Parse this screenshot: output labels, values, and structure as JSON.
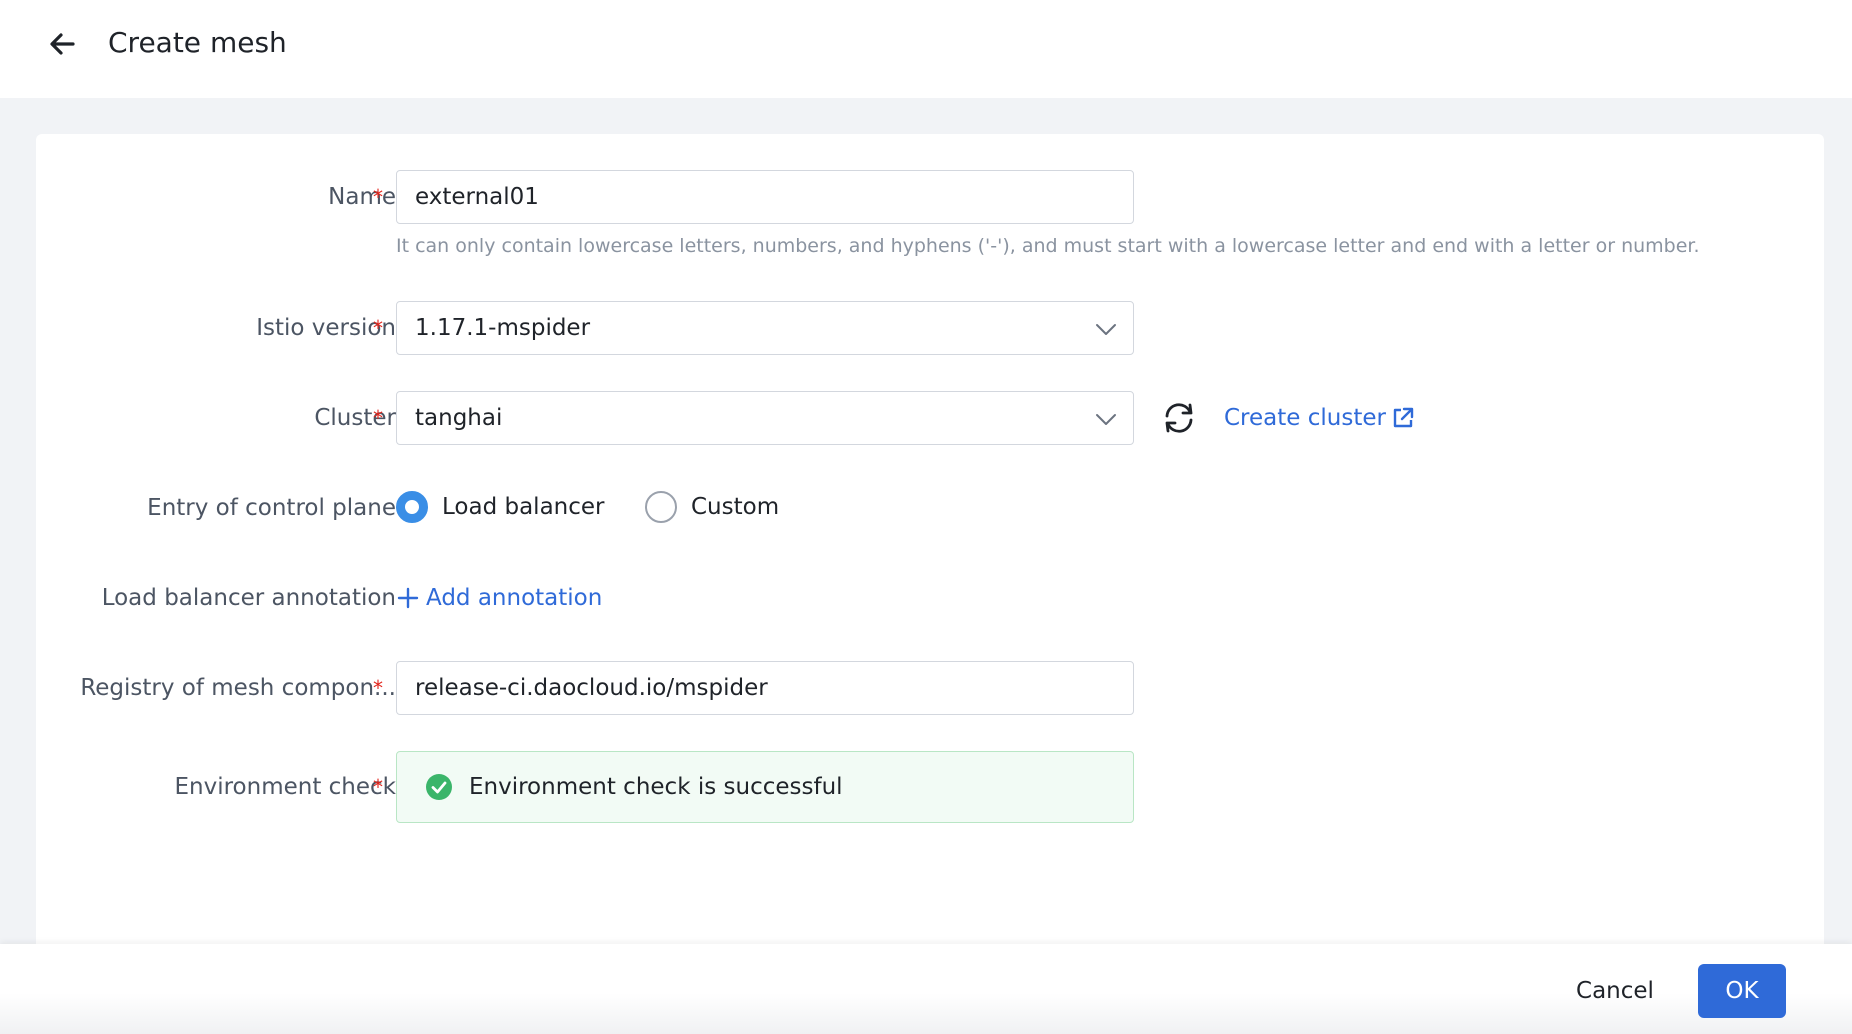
{
  "header": {
    "title": "Create mesh",
    "back_icon": "arrow-left-icon"
  },
  "form": {
    "name": {
      "label": "Name",
      "required": "*",
      "value": "external01",
      "hint": "It can only contain lowercase letters, numbers, and hyphens ('-'), and must start with a lowercase letter and end with a letter or number."
    },
    "istio_version": {
      "label": "Istio version",
      "required": "*",
      "value": "1.17.1-mspider"
    },
    "cluster": {
      "label": "Cluster",
      "required": "*",
      "value": "tanghai",
      "create_link": "Create cluster"
    },
    "entry": {
      "label": "Entry of control plane",
      "options": [
        "Load balancer",
        "Custom"
      ],
      "selected": "Load balancer"
    },
    "lb_annotation": {
      "label": "Load balancer annotation",
      "add_link": "Add annotation"
    },
    "registry": {
      "label": "Registry of mesh compon...",
      "required": "*",
      "value": "release-ci.daocloud.io/mspider"
    },
    "env_check": {
      "label": "Environment check",
      "required": "*",
      "status": "Environment check is successful"
    }
  },
  "footer": {
    "cancel_label": "Cancel",
    "ok_label": "OK"
  },
  "colors": {
    "accent": "#2f6ad8",
    "required": "#e2231a",
    "success": "#3bb56a",
    "radio_selected": "#3a8ee6"
  }
}
